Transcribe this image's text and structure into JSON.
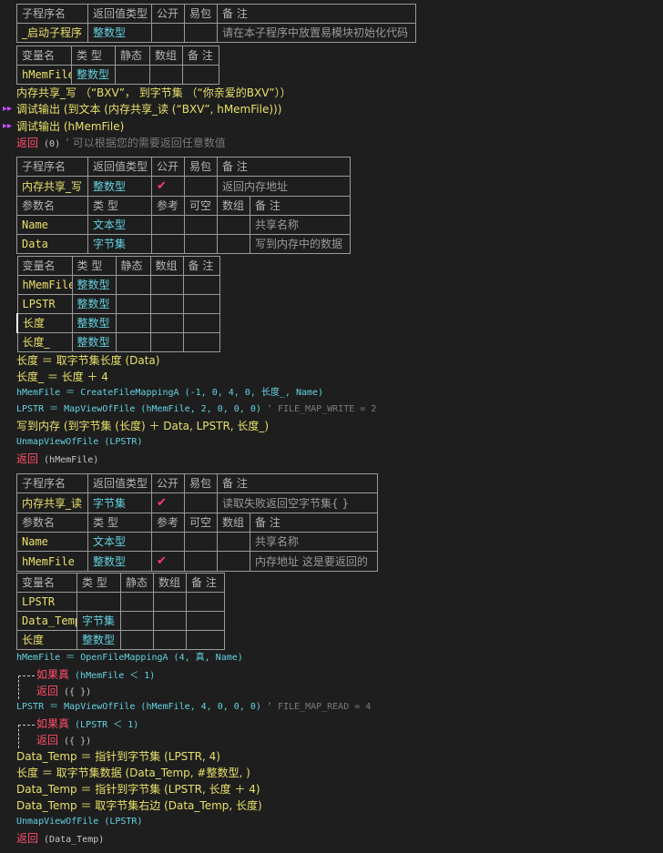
{
  "hdr": {
    "sub": "子程序名",
    "ret": "返回值类型",
    "pub": "公开",
    "easy": "易包",
    "note": "备 注",
    "var": "变量名",
    "type": "类 型",
    "static": "静态",
    "arr": "数组",
    "param": "参数名",
    "ref": "参考",
    "opt": "可空"
  },
  "sub1": {
    "name": "_启动子程序",
    "ret": "整数型",
    "note": "请在本子程序中放置易模块初始化代码",
    "vars": [
      {
        "name": "hMemFile",
        "type": "整数型"
      }
    ]
  },
  "sub2": {
    "name": "内存共享_写",
    "ret": "整数型",
    "note": "返回内存地址",
    "params": [
      {
        "name": "Name",
        "type": "文本型",
        "note": "共享名称"
      },
      {
        "name": "Data",
        "type": "字节集",
        "note": "写到内存中的数据"
      }
    ],
    "vars": [
      {
        "name": "hMemFile",
        "type": "整数型"
      },
      {
        "name": "LPSTR",
        "type": "整数型"
      },
      {
        "name": "长度",
        "type": "整数型"
      },
      {
        "name": "长度_",
        "type": "整数型"
      }
    ]
  },
  "sub3": {
    "name": "内存共享_读",
    "ret": "字节集",
    "note": "读取失败返回空字节集{ }",
    "params": [
      {
        "name": "Name",
        "type": "文本型",
        "note": "共享名称"
      },
      {
        "name": "hMemFile",
        "type": "整数型",
        "note": "内存地址 这是要返回的"
      }
    ],
    "vars": [
      {
        "name": "LPSTR",
        "type": "",
        "note": ""
      },
      {
        "name": "Data_Temp",
        "type": "字节集"
      },
      {
        "name": "长度",
        "type": "整数型"
      }
    ]
  },
  "code": {
    "c1": "内存共享_写 （“BXV”， 到字节集 （“你亲爱的BXV”））",
    "c2": "调试输出 (到文本 (内存共享_读 (“BXV”, hMemFile)))",
    "c3": "调试输出 (hMemFile)",
    "c4a": "返回",
    "c4b": " (0) ",
    "c4c": "’ 可以根据您的需要返回任意数值",
    "d1": "长度 ＝ 取字节集长度 (Data)",
    "d2": "长度_ ＝ 长度 ＋ 4",
    "d3": "hMemFile ＝ CreateFileMappingA (-1, 0, 4, 0, 长度_, Name)",
    "d4a": "LPSTR ＝ MapViewOfFile (hMemFile, 2, 0, 0, 0)",
    "d4b": "  ’ FILE_MAP_WRITE = 2",
    "d5": "写到内存 (到字节集 (长度) ＋ Data, LPSTR, 长度_)",
    "d6": "UnmapViewOfFile (LPSTR)",
    "d7a": "返回",
    "d7b": " (hMemFile)",
    "e1": "hMemFile ＝ OpenFileMappingA (4, 真, Name)",
    "e2a": "如果真",
    "e2b": " (hMemFile ＜ 1)",
    "e3a": "返回",
    "e3b": " ({ })",
    "e4a": "LPSTR ＝ MapViewOfFile (hMemFile, 4, 0, 0, 0)",
    "e4b": "  ’ FILE_MAP_READ = 4",
    "e5a": "如果真",
    "e5b": " (LPSTR ＜ 1)",
    "e6a": "返回",
    "e6b": " ({ })",
    "e7": "Data_Temp ＝ 指针到字节集 (LPSTR, 4)",
    "e8": "长度 ＝ 取字节集数据 (Data_Temp, #整数型, )",
    "e9": "Data_Temp ＝ 指针到字节集 (LPSTR, 长度 ＋ 4)",
    "e10": "Data_Temp ＝ 取字节集右边 (Data_Temp, 长度)",
    "e11": "UnmapViewOfFile (LPSTR)",
    "e12a": "返回",
    "e12b": " (Data_Temp)"
  },
  "colors": {
    "keyword": "#ff4d6a",
    "func": "#e8e06a",
    "var": "#64d2e0",
    "number": "#b98cff",
    "comment": "#7a7a7a",
    "string": "#ffb347",
    "check": "#ff3d6e",
    "marker": "#c64dff"
  },
  "icons": {
    "check": "✔",
    "bp": "▸▸"
  }
}
